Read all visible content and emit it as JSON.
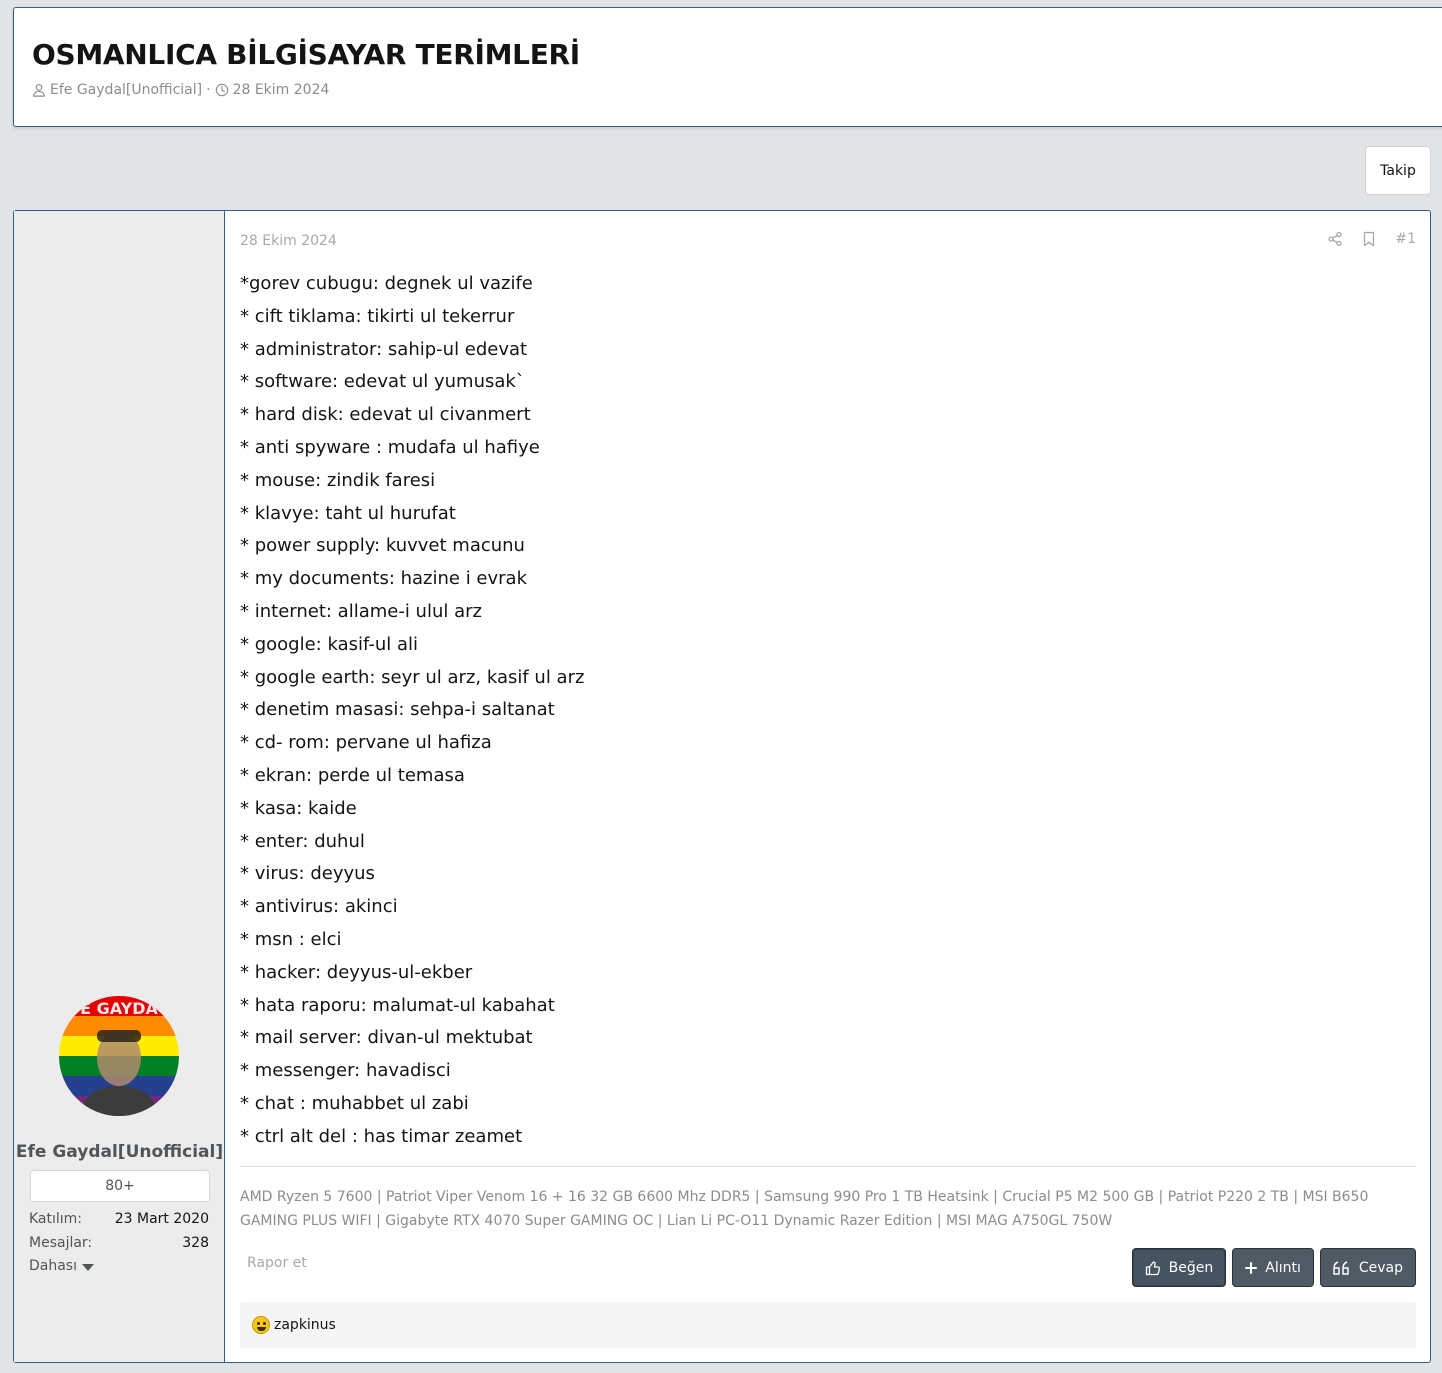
{
  "thread": {
    "title": "OSMANLICA BİLGİSAYAR TERİMLERİ",
    "author": "Efe Gaydal[Unofficial]",
    "date": "28 Ekim 2024"
  },
  "follow_label": "Takip",
  "post": {
    "date": "28 Ekim 2024",
    "number": "#1",
    "lines": [
      "*gorev cubugu: degnek ul vazife",
      "* cift tiklama: tikirti ul tekerrur",
      "* administrator: sahip-ul edevat",
      "* software: edevat ul yumusak`",
      "* hard disk: edevat ul civanmert",
      "* anti spyware : mudafa ul hafiye",
      "* mouse: zindik faresi",
      "* klavye: taht ul hurufat",
      "* power supply: kuvvet macunu",
      "* my documents: hazine i evrak",
      "* internet: allame-i ulul arz",
      "* google: kasif-ul ali",
      "* google earth: seyr ul arz, kasif ul arz",
      "* denetim masasi: sehpa-i saltanat",
      "* cd- rom: pervane ul hafiza",
      "* ekran: perde ul temasa",
      "* kasa: kaide",
      "* enter: duhul",
      "* virus: deyyus",
      "* antivirus: akinci",
      "* msn : elci",
      "* hacker: deyyus-ul-ekber",
      "* hata raporu: malumat-ul kabahat",
      "* mail server: divan-ul mektubat",
      "* messenger: havadisci",
      "* chat : muhabbet ul zabi",
      "* ctrl alt del : has timar zeamet"
    ],
    "signature": "AMD Ryzen 5 7600 | Patriot Viper Venom 16 + 16 32 GB 6600 Mhz DDR5 | Samsung 990 Pro 1 TB Heatsink | Crucial P5 M2 500 GB | Patriot P220 2 TB | MSI B650 GAMING PLUS WIFI | Gigabyte RTX 4070 Super GAMING OC | Lian Li PC-O11 Dynamic Razer Edition | MSI MAG A750GL 750W",
    "report_label": "Rapor et",
    "buttons": {
      "like": "Beğen",
      "quote": "Alıntı",
      "reply": "Cevap"
    },
    "reactions": {
      "icon": "rofl-emoji-icon",
      "users": "zapkinus"
    }
  },
  "user": {
    "name": "Efe Gaydal[Unofficial]",
    "banner": "80+",
    "joined_label": "Katılım:",
    "joined_value": "23 Mart 2020",
    "messages_label": "Mesajlar:",
    "messages_value": "328",
    "more_label": "Dahası"
  },
  "colors": {
    "accent_border": "#2f5f91",
    "button_bg": "#4f5a64",
    "page_bg": "#e2e3e5"
  }
}
